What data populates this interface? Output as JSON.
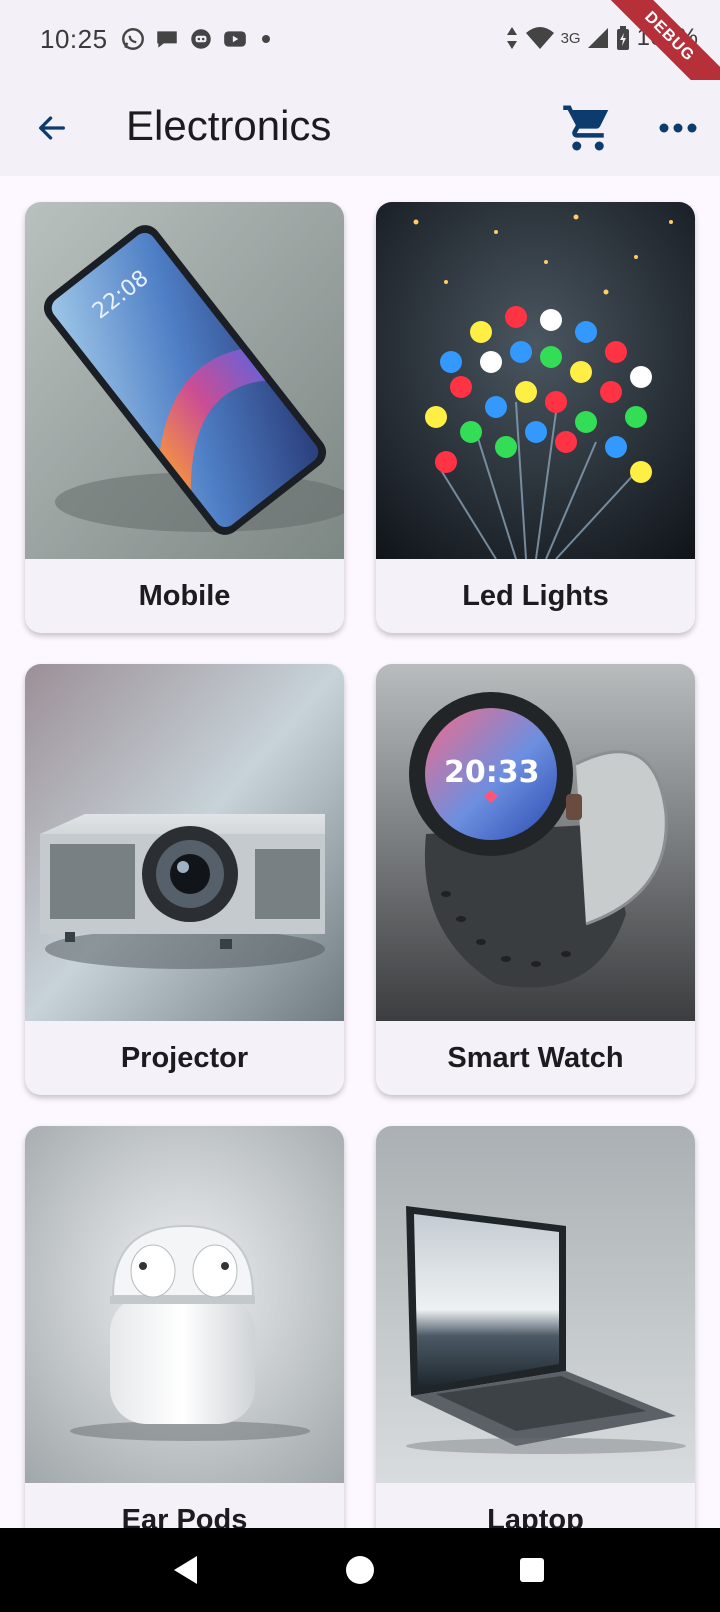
{
  "status_bar": {
    "time": "10:25",
    "network": "3G",
    "battery": "100%",
    "left_icons": [
      "whatsapp-icon",
      "chat-icon",
      "robot-icon",
      "youtube-icon"
    ],
    "debug_banner": "DEBUG"
  },
  "app_bar": {
    "title": "Electronics",
    "back_icon": "arrow-left-icon",
    "cart_icon": "shopping-cart-icon",
    "more_icon": "more-horizontal-icon"
  },
  "products": [
    {
      "label": "Mobile"
    },
    {
      "label": "Led Lights"
    },
    {
      "label": "Projector"
    },
    {
      "label": "Smart Watch"
    },
    {
      "label": "Ear Pods"
    },
    {
      "label": "Laptop"
    }
  ],
  "nav_bar": [
    "back-triangle-icon",
    "home-circle-icon",
    "recents-square-icon"
  ],
  "colors": {
    "app_bar_bg": "#f3f0f7",
    "accent": "#0d3b6e",
    "page_bg": "#fdf7ff",
    "card_bg": "#f5f1f8"
  }
}
